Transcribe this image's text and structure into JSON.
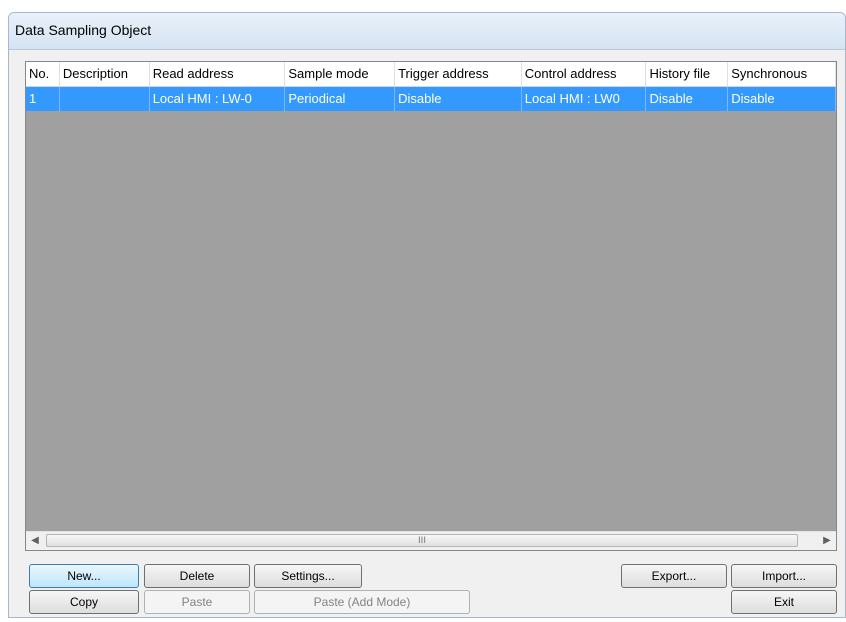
{
  "window": {
    "title": "Data Sampling Object"
  },
  "table": {
    "columns": [
      "No.",
      "Description",
      "Read address",
      "Sample mode",
      "Trigger address",
      "Control address",
      "History file",
      "Synchronous"
    ],
    "rows": [
      {
        "no": "1",
        "description": "",
        "read_address": "Local HMI : LW-0",
        "sample_mode": "Periodical",
        "trigger_address": "Disable",
        "control_address": "Local HMI : LW0",
        "history_file": "Disable",
        "synchronous": "Disable"
      }
    ]
  },
  "scrollbar": {
    "grip": "III"
  },
  "buttons": {
    "new": "New...",
    "delete": "Delete",
    "settings": "Settings...",
    "export": "Export...",
    "import": "Import...",
    "copy": "Copy",
    "paste": "Paste",
    "paste_add_mode": "Paste (Add Mode)",
    "exit": "Exit"
  }
}
